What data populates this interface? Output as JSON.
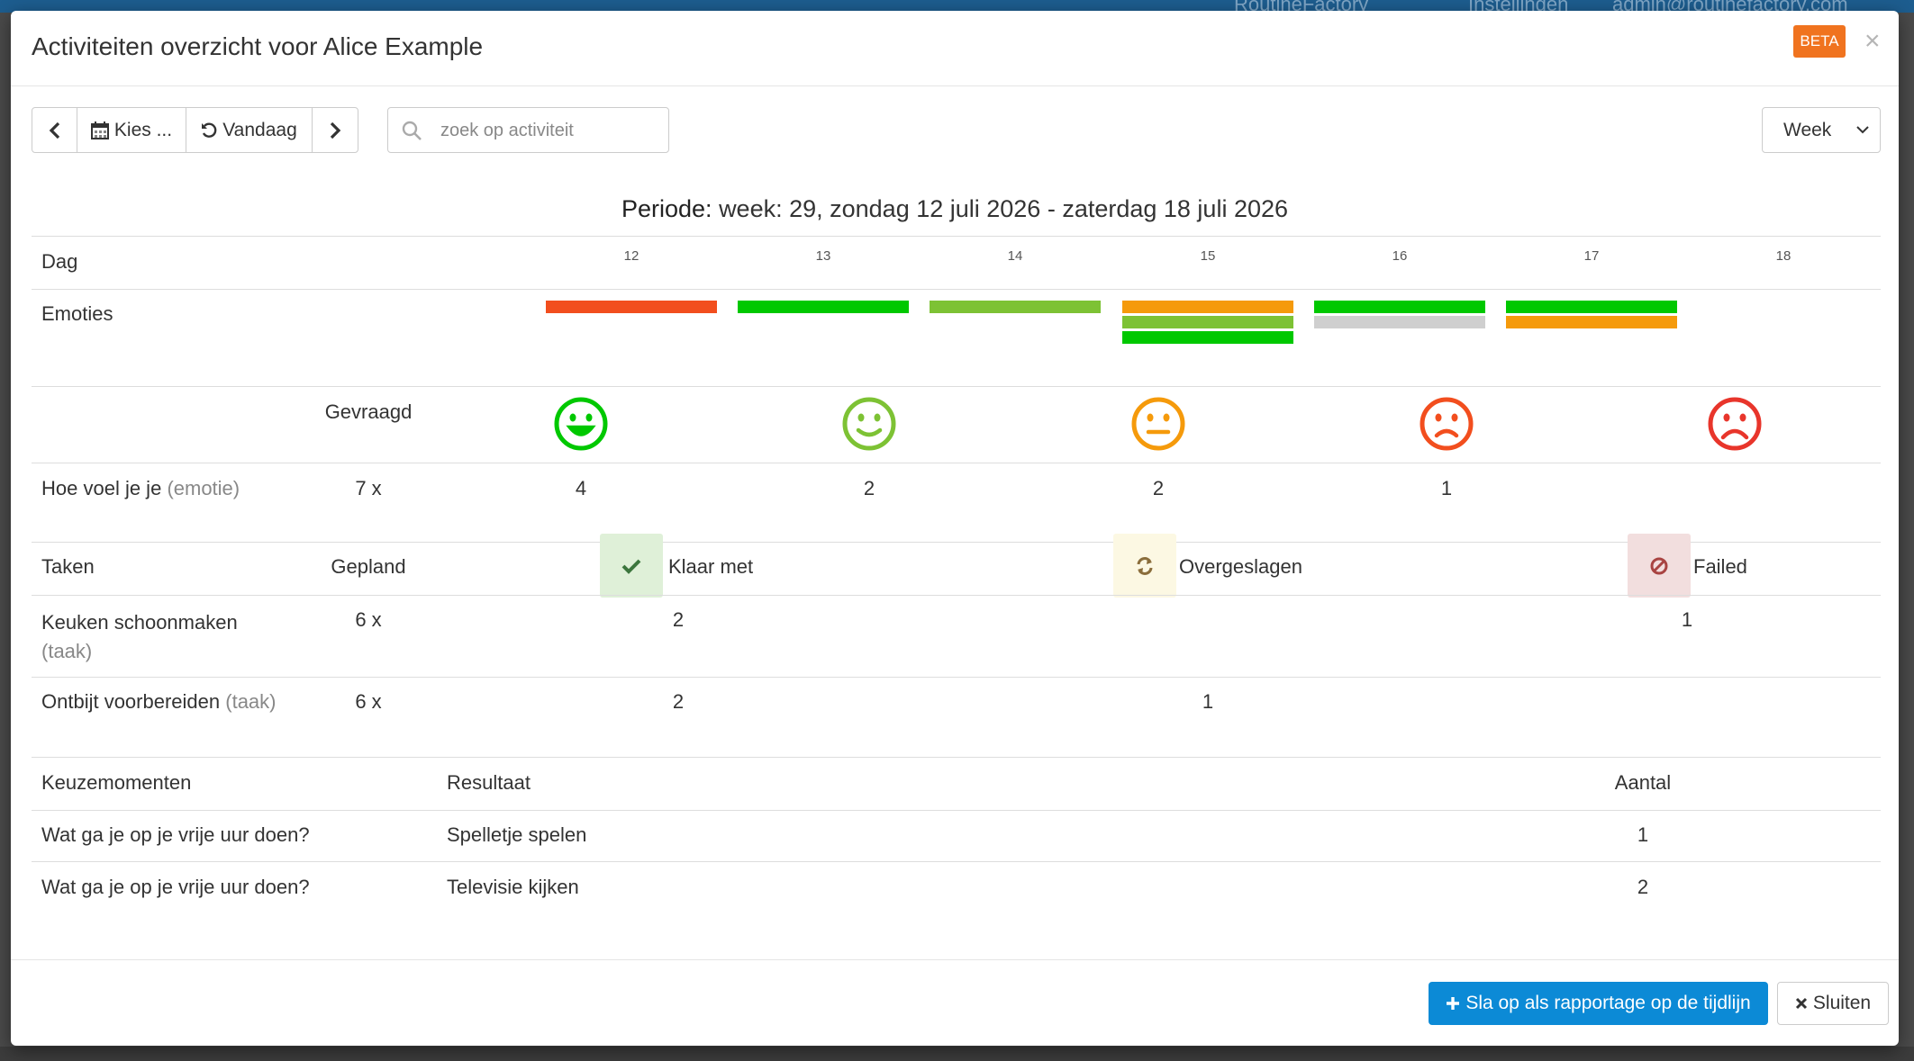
{
  "background": {
    "ghost_items": [
      "RoutineFactory",
      "Instellingen",
      "admin@routinefactory.com"
    ]
  },
  "modal": {
    "title": "Activiteiten overzicht voor Alice Example",
    "beta": "BETA",
    "close": "×"
  },
  "toolbar": {
    "prev_icon": "chevron-left-icon",
    "choose_label": "Kies ...",
    "today_label": "Vandaag",
    "next_icon": "chevron-right-icon",
    "search_placeholder": "zoek op activiteit",
    "search_value": "",
    "period_select": "Week"
  },
  "period": {
    "label": "Periode:",
    "text": "week: 29, zondag 12 juli 2026 - zaterdag 18 juli 2026"
  },
  "days": {
    "header": "Dag",
    "values": [
      "12",
      "13",
      "14",
      "15",
      "16",
      "17",
      "18"
    ]
  },
  "emotions": {
    "header": "Emoties",
    "colors": {
      "very_happy": "#00c800",
      "happy": "#7dc234",
      "neutral": "#f59a0b",
      "sad": "#f24e1e",
      "unknown": "#cfcfcf"
    },
    "bars_per_day": [
      [
        "sad"
      ],
      [
        "very_happy"
      ],
      [
        "happy"
      ],
      [
        "neutral",
        "happy",
        "very_happy"
      ],
      [
        "very_happy",
        "unknown"
      ],
      [
        "very_happy",
        "neutral"
      ],
      []
    ]
  },
  "emotion_summary": {
    "asked_header": "Gevraagd",
    "smileys": [
      {
        "icon": "very-happy-smiley-icon",
        "color": "#00c800"
      },
      {
        "icon": "happy-smiley-icon",
        "color": "#7dc234"
      },
      {
        "icon": "neutral-smiley-icon",
        "color": "#f59a0b"
      },
      {
        "icon": "sad-smiley-icon",
        "color": "#f24e1e"
      },
      {
        "icon": "very-sad-smiley-icon",
        "color": "#e8352b"
      }
    ],
    "row_label": "Hoe voel je je",
    "row_type": "(emotie)",
    "asked": "7 x",
    "counts": [
      "4",
      "2",
      "2",
      "1",
      ""
    ]
  },
  "tasks": {
    "header": "Taken",
    "planned_header": "Gepland",
    "statuses": [
      {
        "label": "Klaar met",
        "icon": "check-icon",
        "bg": "#dff0d8",
        "color": "#3c763d"
      },
      {
        "label": "Overgeslagen",
        "icon": "refresh-icon",
        "bg": "#fcf8e3",
        "color": "#8a6d3b"
      },
      {
        "label": "Failed",
        "icon": "ban-icon",
        "bg": "#f2dede",
        "color": "#a94442"
      }
    ],
    "rows": [
      {
        "name_line1": "Keuken schoonmaken",
        "type": "(taak)",
        "planned": "6 x",
        "done": "2",
        "skipped": "",
        "failed": "1"
      },
      {
        "name_line1": "Ontbijt voorbereiden",
        "type": "(taak)",
        "planned": "6 x",
        "done": "2",
        "skipped": "1",
        "failed": ""
      }
    ]
  },
  "choices": {
    "header": "Keuzemomenten",
    "result_header": "Resultaat",
    "count_header": "Aantal",
    "rows": [
      {
        "question": "Wat ga je op je vrije uur doen?",
        "result": "Spelletje spelen",
        "count": "1"
      },
      {
        "question": "Wat ga je op je vrije uur doen?",
        "result": "Televisie kijken",
        "count": "2"
      }
    ]
  },
  "footer": {
    "save_label": "Sla op als rapportage op de tijdlijn",
    "close_label": "Sluiten"
  }
}
